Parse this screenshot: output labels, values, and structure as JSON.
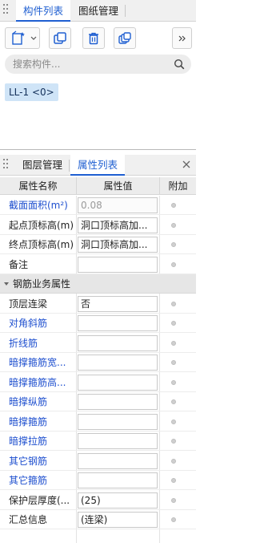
{
  "top_panel": {
    "tabs": [
      {
        "label": "构件列表",
        "active": true
      },
      {
        "label": "图纸管理",
        "active": false
      }
    ],
    "toolbar": {
      "icons": [
        "new-component-icon",
        "dropdown-arrow-icon",
        "copy-icon",
        "delete-icon",
        "duplicate-layer-icon",
        "expand-more-icon"
      ]
    },
    "search": {
      "placeholder": "搜索构件..."
    },
    "components": [
      {
        "label": "LL-1 <0>"
      }
    ]
  },
  "bottom_panel": {
    "tabs": [
      {
        "label": "图层管理",
        "active": false
      },
      {
        "label": "属性列表",
        "active": true
      }
    ],
    "columns": {
      "name": "属性名称",
      "value": "属性值",
      "extra": "附加"
    },
    "rows": [
      {
        "name": "截面面积(m²)",
        "value": "0.08",
        "blue": true,
        "readonly": true
      },
      {
        "name": "起点顶标高(m)",
        "value": "洞口顶标高加...",
        "blue": false
      },
      {
        "name": "终点顶标高(m)",
        "value": "洞口顶标高加...",
        "blue": false
      },
      {
        "name": "备注",
        "value": "",
        "blue": false
      }
    ],
    "group": {
      "label": "钢筋业务属性"
    },
    "group_rows": [
      {
        "name": "顶层连梁",
        "value": "否",
        "blue": false
      },
      {
        "name": "对角斜筋",
        "value": "",
        "blue": true
      },
      {
        "name": "折线筋",
        "value": "",
        "blue": true
      },
      {
        "name": "暗撑箍筋宽...",
        "value": "",
        "blue": true
      },
      {
        "name": "暗撑箍筋高...",
        "value": "",
        "blue": true
      },
      {
        "name": "暗撑纵筋",
        "value": "",
        "blue": true
      },
      {
        "name": "暗撑箍筋",
        "value": "",
        "blue": true
      },
      {
        "name": "暗撑拉筋",
        "value": "",
        "blue": true
      },
      {
        "name": "其它钢筋",
        "value": "",
        "blue": true
      },
      {
        "name": "其它箍筋",
        "value": "",
        "blue": true
      },
      {
        "name": "保护层厚度(...",
        "value": "(25)",
        "blue": false
      },
      {
        "name": "汇总信息",
        "value": "(连梁)",
        "blue": false
      }
    ]
  },
  "colors": {
    "accent": "#1f5fd1",
    "blue_text": "#1e4fcf",
    "chip_bg": "#cfe4f7"
  }
}
